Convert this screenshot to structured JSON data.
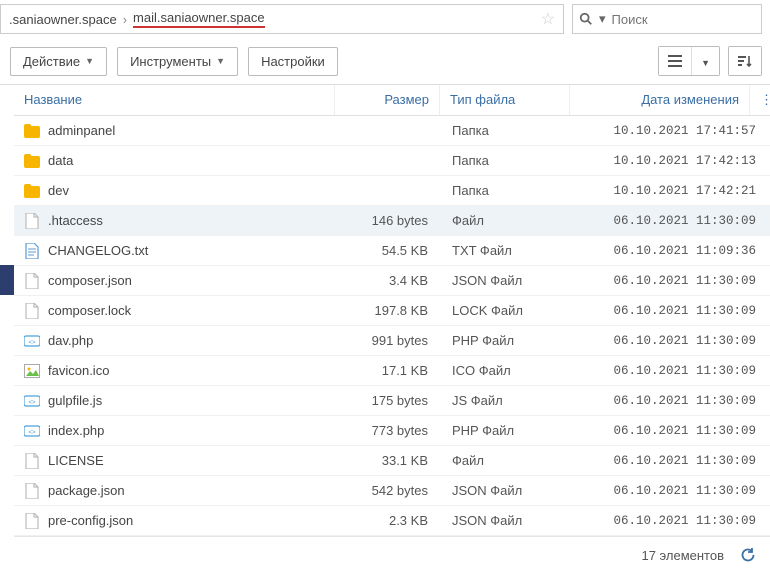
{
  "breadcrumb": {
    "part1": ".saniaowner.space",
    "part2": "mail.saniaowner.space"
  },
  "search": {
    "placeholder": "Поиск"
  },
  "toolbar": {
    "action": "Действие",
    "tools": "Инструменты",
    "settings": "Настройки"
  },
  "columns": {
    "name": "Название",
    "size": "Размер",
    "type": "Тип файла",
    "date": "Дата изменения"
  },
  "rows": [
    {
      "icon": "folder",
      "name": "adminpanel",
      "size": "",
      "type": "Папка",
      "date": "10.10.2021 17:41:57",
      "selected": false
    },
    {
      "icon": "folder",
      "name": "data",
      "size": "",
      "type": "Папка",
      "date": "10.10.2021 17:42:13",
      "selected": false
    },
    {
      "icon": "folder",
      "name": "dev",
      "size": "",
      "type": "Папка",
      "date": "10.10.2021 17:42:21",
      "selected": false
    },
    {
      "icon": "file",
      "name": ".htaccess",
      "size": "146 bytes",
      "type": "Файл",
      "date": "06.10.2021 11:30:09",
      "selected": true
    },
    {
      "icon": "txt",
      "name": "CHANGELOG.txt",
      "size": "54.5 KB",
      "type": "TXT Файл",
      "date": "06.10.2021 11:09:36",
      "selected": false
    },
    {
      "icon": "file",
      "name": "composer.json",
      "size": "3.4 KB",
      "type": "JSON Файл",
      "date": "06.10.2021 11:30:09",
      "selected": false
    },
    {
      "icon": "file",
      "name": "composer.lock",
      "size": "197.8 KB",
      "type": "LOCK Файл",
      "date": "06.10.2021 11:30:09",
      "selected": false
    },
    {
      "icon": "php",
      "name": "dav.php",
      "size": "991 bytes",
      "type": "PHP Файл",
      "date": "06.10.2021 11:30:09",
      "selected": false
    },
    {
      "icon": "img",
      "name": "favicon.ico",
      "size": "17.1 KB",
      "type": "ICO Файл",
      "date": "06.10.2021 11:30:09",
      "selected": false
    },
    {
      "icon": "php",
      "name": "gulpfile.js",
      "size": "175 bytes",
      "type": "JS Файл",
      "date": "06.10.2021 11:30:09",
      "selected": false
    },
    {
      "icon": "php",
      "name": "index.php",
      "size": "773 bytes",
      "type": "PHP Файл",
      "date": "06.10.2021 11:30:09",
      "selected": false
    },
    {
      "icon": "file",
      "name": "LICENSE",
      "size": "33.1 KB",
      "type": "Файл",
      "date": "06.10.2021 11:30:09",
      "selected": false
    },
    {
      "icon": "file",
      "name": "package.json",
      "size": "542 bytes",
      "type": "JSON Файл",
      "date": "06.10.2021 11:30:09",
      "selected": false
    },
    {
      "icon": "file",
      "name": "pre-config.json",
      "size": "2.3 KB",
      "type": "JSON Файл",
      "date": "06.10.2021 11:30:09",
      "selected": false
    }
  ],
  "footer": {
    "count": "17 элементов"
  }
}
